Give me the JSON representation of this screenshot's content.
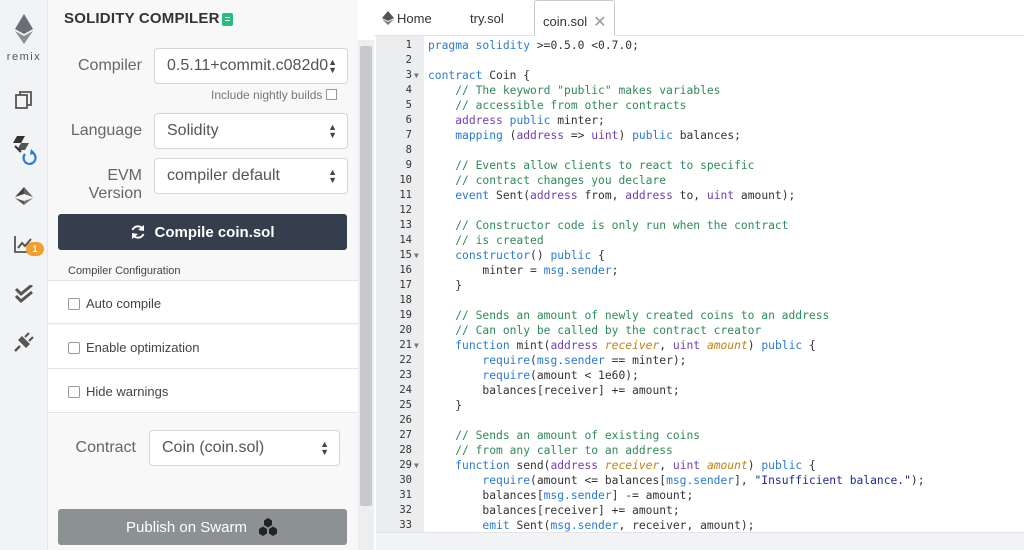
{
  "rail": {
    "logo_text": "remix",
    "badge": "1"
  },
  "panel": {
    "title": "SOLIDITY COMPILER",
    "compiler_label": "Compiler",
    "compiler_value": "0.5.11+commit.c082d0",
    "nightly_label": "Include nightly builds",
    "language_label": "Language",
    "language_value": "Solidity",
    "evm_label": "EVM Version",
    "evm_value": "compiler default",
    "compile_button": "Compile coin.sol",
    "config_title": "Compiler Configuration",
    "options": [
      "Auto compile",
      "Enable optimization",
      "Hide warnings"
    ],
    "contract_label": "Contract",
    "contract_value": "Coin (coin.sol)",
    "publish_button": "Publish on Swarm"
  },
  "tabs": [
    {
      "label": "Home"
    },
    {
      "label": "try.sol"
    },
    {
      "label": "coin.sol",
      "active": true
    }
  ],
  "code_lines": [
    "pragma solidity >=0.5.0 <0.7.0;",
    "",
    "contract Coin {",
    "    // The keyword \"public\" makes variables",
    "    // accessible from other contracts",
    "    address public minter;",
    "    mapping (address => uint) public balances;",
    "",
    "    // Events allow clients to react to specific",
    "    // contract changes you declare",
    "    event Sent(address from, address to, uint amount);",
    "",
    "    // Constructor code is only run when the contract",
    "    // is created",
    "    constructor() public {",
    "        minter = msg.sender;",
    "    }",
    "",
    "    // Sends an amount of newly created coins to an address",
    "    // Can only be called by the contract creator",
    "    function mint(address receiver, uint amount) public {",
    "        require(msg.sender == minter);",
    "        require(amount < 1e60);",
    "        balances[receiver] += amount;",
    "    }",
    "",
    "    // Sends an amount of existing coins",
    "    // from any caller to an address",
    "    function send(address receiver, uint amount) public {",
    "        require(amount <= balances[msg.sender], \"Insufficient balance.\");",
    "        balances[msg.sender] -= amount;",
    "        balances[receiver] += amount;",
    "        emit Sent(msg.sender, receiver, amount);"
  ],
  "fold_lines": [
    3,
    15,
    21,
    29
  ]
}
